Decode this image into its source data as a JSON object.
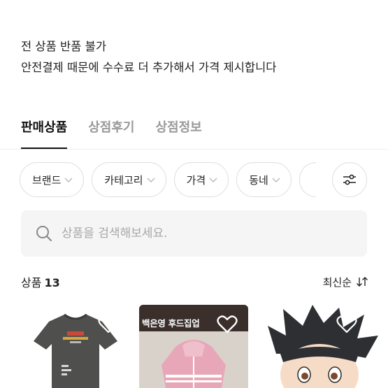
{
  "notice": {
    "line1": "전 상품 반품 불가",
    "line2": "안전결제 때문에 수수료 더 추가해서 가격 제시합니다"
  },
  "tabs": [
    {
      "label": "판매상품",
      "active": true
    },
    {
      "label": "상점후기",
      "active": false
    },
    {
      "label": "상점정보",
      "active": false
    }
  ],
  "filters": {
    "chips": [
      "브랜드",
      "카테고리",
      "가격",
      "동네"
    ],
    "settings_icon": "sliders-icon"
  },
  "search": {
    "placeholder": "상품을 검색해보세요.",
    "value": ""
  },
  "products_summary": {
    "label": "상품",
    "count": "13",
    "sort_label": "최신순"
  },
  "products": [
    {
      "name": "grey-tshirt",
      "label": ""
    },
    {
      "name": "pink-hoodie",
      "label": "백은영 후드집업"
    },
    {
      "name": "figure-head",
      "label": ""
    }
  ],
  "colors": {
    "text": "#1a1a1a",
    "muted": "#9a9a9a",
    "search_bg": "#f5f5f5",
    "hoodie_pink": "#e8a7b8"
  }
}
